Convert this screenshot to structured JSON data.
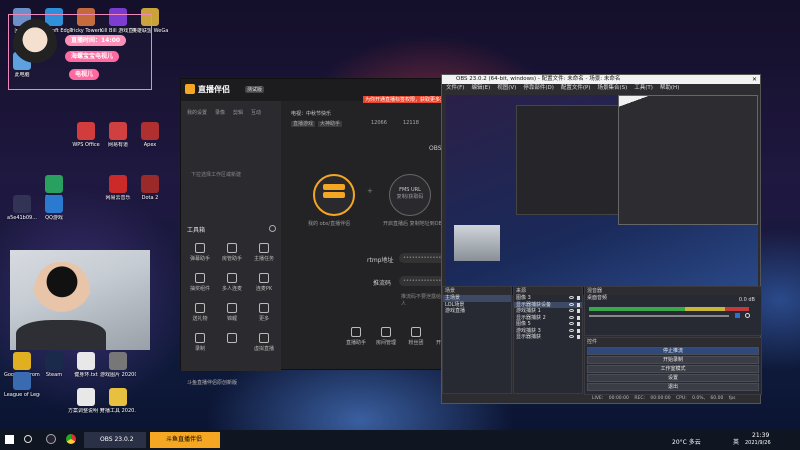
{
  "desktop_icons": [
    {
      "label": "回收站",
      "color": "#6b8fc7"
    },
    {
      "label": "Microsoft Edge",
      "color": "#2b8fd9"
    },
    {
      "label": "Tricky Towers",
      "color": "#c46a3a"
    },
    {
      "label": "Kill Bill 游戏直播",
      "color": "#7a3ad0"
    },
    {
      "label": "英雄联盟 WeGame",
      "color": "#caa23a"
    },
    {
      "label": "此电脑",
      "color": "#5aa0e0"
    },
    {
      "label": "WPS Office",
      "color": "#d23c3c"
    },
    {
      "label": "网易有道",
      "color": "#d04040"
    },
    {
      "label": "Apex",
      "color": "#b03030"
    },
    {
      "label": "QQ音乐",
      "color": "#2aa060"
    },
    {
      "label": "网易云音乐",
      "color": "#cc2a2a"
    },
    {
      "label": "Dota 2",
      "color": "#9a2a2a"
    },
    {
      "label": "a5e41b09...",
      "color": "#333355"
    },
    {
      "label": "QQ游戏",
      "color": "#2a7ad0"
    },
    {
      "label": "Google Chrome",
      "color": "#e0b020"
    },
    {
      "label": "Steam",
      "color": "#1a2a4a"
    },
    {
      "label": "健身环.txt",
      "color": "#e8e8e8"
    },
    {
      "label": "游戏图片 2020061...",
      "color": "#777777"
    },
    {
      "label": "League of Legends",
      "color": "#3a6ab0"
    },
    {
      "label": "方案调整说明 完善.txt",
      "color": "#e8e8e8"
    },
    {
      "label": "开播工具 2020...",
      "color": "#e8c040"
    }
  ],
  "overlay": {
    "time_badge": "直播时间：14:00",
    "line1": "海螺宝宝电视儿",
    "line2": "电视儿"
  },
  "live_app": {
    "logo": "直播伴侣",
    "version": "测试版",
    "promo": "为你开通直播标签权限，获取更多流量！",
    "tabs": [
      "我的设置",
      "录像",
      "剪辑",
      "互动"
    ],
    "stream_title": "电视：中秋节快乐",
    "tags": [
      "直播游戏",
      "大神助手"
    ],
    "counter1": "12066",
    "counter2": "12118",
    "side_hint": "下拉选择工作区或新建",
    "tool_title": "工具箱",
    "tools": [
      "弹幕助手",
      "房管助手",
      "主播任务",
      "抽奖组件",
      "多人连麦",
      "连麦PK",
      "送礼物",
      "锦鲤",
      "更多",
      "录制",
      "",
      "虚拟直播"
    ],
    "mode_label": "OBS",
    "circle1_label": "我的 obs/直播伴侣",
    "circle2_label": "FMS URL",
    "circle2_sub": "复制/获取码",
    "hint2": "开启直播后 复制地址到OBS",
    "rtmp_label": "rtmp地址",
    "key_label": "推流码",
    "dots": "•••••••••••••",
    "key_hint": "推流码不要泄露给他人",
    "bottom_actions": [
      "直播助手",
      "房间管理",
      "粉丝团",
      "开播工具"
    ],
    "footer": "斗鱼直播伴侣原创新版"
  },
  "obs": {
    "title": "OBS 23.0.2 (64-bit, windows) - 配置文件: 未命名 - 场景: 未命名",
    "menu": [
      "文件(F)",
      "编辑(E)",
      "视图(V)",
      "停靠部件(D)",
      "配置文件(P)",
      "场景集合(S)",
      "工具(T)",
      "帮助(H)"
    ],
    "scenes_header": "场景",
    "scenes": [
      "主场景",
      "LOL场景",
      "游戏直播"
    ],
    "sources_header": "来源",
    "sources": [
      "图像 3",
      "显示器捕获设备",
      "游戏捕获 1",
      "显示器捕获 2",
      "图像 5",
      "游戏捕获 3",
      "显示器捕获"
    ],
    "mixer_header": "混音器",
    "mixer_label": "桌面音频",
    "mixer_value": "0.0 dB",
    "controls_header": "控件",
    "controls": [
      "停止推流",
      "开始录制",
      "工作室模式",
      "设置",
      "退出"
    ],
    "status": "LIVE: 00:00:00   REC: 00:00:00   CPU: 0.0%, 60.00 fps"
  },
  "taskbar": {
    "apps": [
      {
        "label": "OBS 23.0.2 (64-bit..."
      },
      {
        "label": "斗鱼直播伴侣"
      }
    ],
    "temp": "20°C 多云",
    "ime": "英",
    "time": "21:39",
    "date": "2021/9/26"
  },
  "colors": {
    "accent": "#f5a623",
    "obs_bg": "#2d2d31",
    "pink": "#ff6aa0"
  }
}
